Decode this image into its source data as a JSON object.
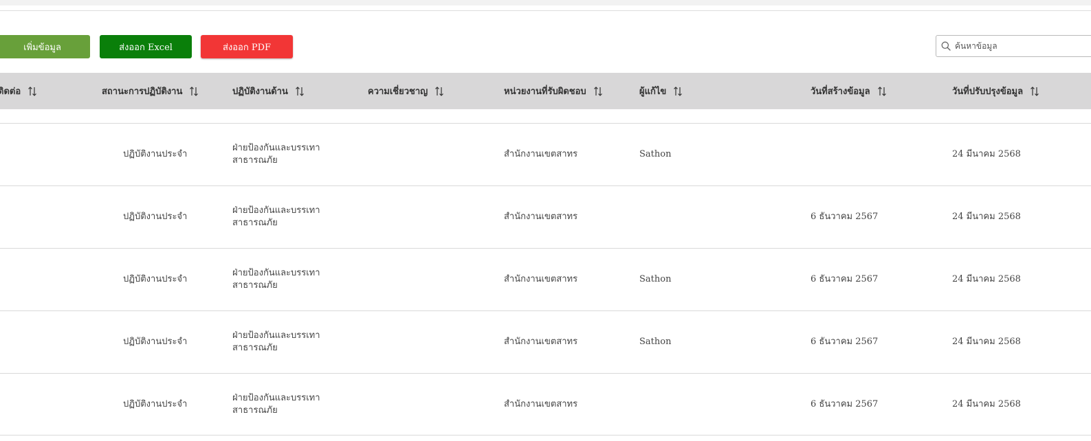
{
  "toolbar": {
    "add_label": "เพิ่มข้อมูล",
    "excel_label": "ส่งออก Excel",
    "pdf_label": "ส่งออก PDF",
    "search_placeholder": "ค้นหาข้อมูล"
  },
  "colors": {
    "add_button": "#68a03a",
    "excel_button": "#0a7f0a",
    "pdf_button": "#f23636",
    "header_bg": "#d8d7d8"
  },
  "icons": {
    "search": "search-icon",
    "sort": "sort-arrows-icon"
  },
  "table": {
    "columns": [
      "ติดต่อ",
      "สถานะการปฏิบัติงาน",
      "ปฏิบัติงานด้าน",
      "ความเชี่ยวชาญ",
      "หน่วยงานที่รับผิดชอบ",
      "ผู้แก้ไข",
      "วันที่สร้างข้อมูล",
      "วันที่ปรับปรุงข้อมูล"
    ],
    "rows": [
      {
        "status": "ปฏิบัติงานประจำ",
        "area_line1": "ฝ่ายป้องกันและบรรเทา",
        "area_line2": "สาธารณภัย",
        "expertise": "",
        "agency": "สำนักงานเขตสาทร",
        "editor": "Sathon",
        "created": "",
        "updated": "24 มีนาคม 2568"
      },
      {
        "status": "ปฏิบัติงานประจำ",
        "area_line1": "ฝ่ายป้องกันและบรรเทา",
        "area_line2": "สาธารณภัย",
        "expertise": "",
        "agency": "สำนักงานเขตสาทร",
        "editor": "",
        "created": "6 ธันวาคม 2567",
        "updated": "24 มีนาคม 2568"
      },
      {
        "status": "ปฏิบัติงานประจำ",
        "area_line1": "ฝ่ายป้องกันและบรรเทา",
        "area_line2": "สาธารณภัย",
        "expertise": "",
        "agency": "สำนักงานเขตสาทร",
        "editor": "Sathon",
        "created": "6 ธันวาคม 2567",
        "updated": "24 มีนาคม 2568"
      },
      {
        "status": "ปฏิบัติงานประจำ",
        "area_line1": "ฝ่ายป้องกันและบรรเทา",
        "area_line2": "สาธารณภัย",
        "expertise": "",
        "agency": "สำนักงานเขตสาทร",
        "editor": "Sathon",
        "created": "6 ธันวาคม 2567",
        "updated": "24 มีนาคม 2568"
      },
      {
        "status": "ปฏิบัติงานประจำ",
        "area_line1": "ฝ่ายป้องกันและบรรเทา",
        "area_line2": "สาธารณภัย",
        "expertise": "",
        "agency": "สำนักงานเขตสาทร",
        "editor": "",
        "created": "6 ธันวาคม 2567",
        "updated": "24 มีนาคม 2568"
      }
    ]
  }
}
